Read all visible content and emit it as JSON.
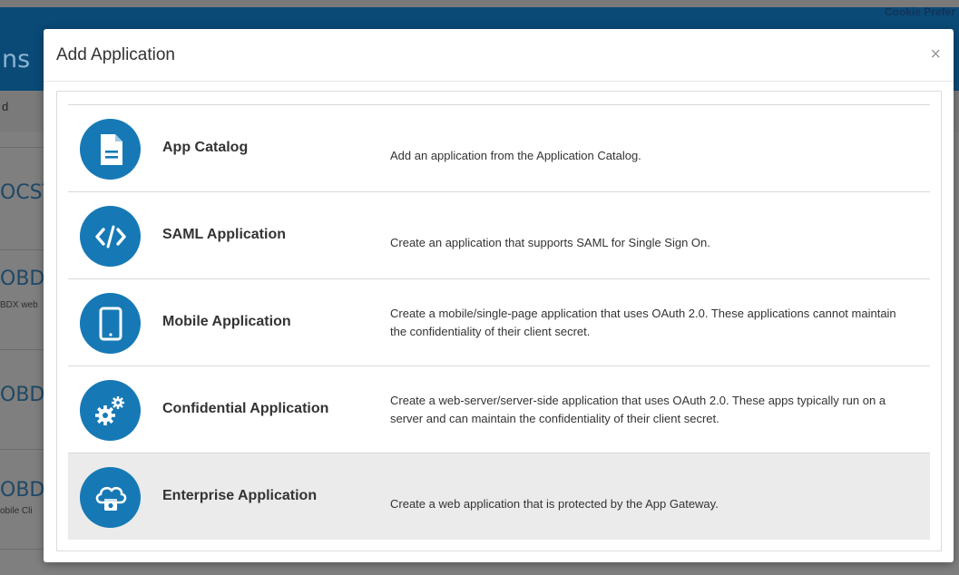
{
  "background": {
    "cookie_link": "Cookie Prefer",
    "page_title_fragment": "ns",
    "subbar_text": "d",
    "list_items": [
      {
        "title": "OCST",
        "subtitle": ""
      },
      {
        "title": "OBDX",
        "subtitle": "BDX web"
      },
      {
        "title": "OBDX",
        "subtitle": ""
      },
      {
        "title": "OBDX",
        "subtitle": "obile Cli"
      }
    ]
  },
  "modal": {
    "title": "Add Application",
    "close_glyph": "×",
    "apps": [
      {
        "name": "App Catalog",
        "description": "Add an application from the Application Catalog.",
        "icon": "document-icon"
      },
      {
        "name": "SAML Application",
        "description": "Create an application that supports SAML for Single Sign On.",
        "icon": "code-icon"
      },
      {
        "name": "Mobile Application",
        "description": "Create a mobile/single-page application that uses OAuth 2.0. These applications cannot maintain the confidentiality of their client secret.",
        "icon": "mobile-icon"
      },
      {
        "name": "Confidential Application",
        "description": "Create a web-server/server-side application that uses OAuth 2.0. These apps typically run on a server and can maintain the confidentiality of their client secret.",
        "icon": "gears-icon"
      },
      {
        "name": "Enterprise Application",
        "description": "Create a web application that is protected by the App Gateway.",
        "icon": "cloud-gateway-icon"
      }
    ]
  },
  "colors": {
    "accent": "#1679b6",
    "header_bg": "#0a4a77",
    "hover_row": "#ebebeb"
  }
}
